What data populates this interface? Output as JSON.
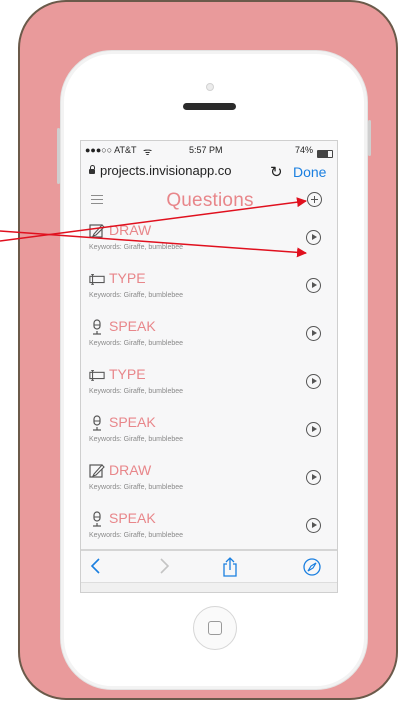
{
  "status_bar": {
    "carrier": "●●●○○ AT&T",
    "wifi": "wifi-icon",
    "time": "5:57 PM",
    "battery": "74%",
    "battery_level": 0.74
  },
  "browser": {
    "url": "projects.invisionapp.co",
    "done_label": "Done"
  },
  "app_bar": {
    "title": "Questions"
  },
  "rows": [
    {
      "title": "DRAW",
      "keywords": "Keywords: Giraffe, bumblebee",
      "icon": "draw-icon"
    },
    {
      "title": "TYPE",
      "keywords": "Keywords: Giraffe, bumblebee",
      "icon": "keyboard-icon"
    },
    {
      "title": "SPEAK",
      "keywords": "Keywords: Giraffe, bumblebee",
      "icon": "microphone-icon"
    },
    {
      "title": "TYPE",
      "keywords": "Keywords: Giraffe, bumblebee",
      "icon": "keyboard-icon"
    },
    {
      "title": "SPEAK",
      "keywords": "Keywords: Giraffe, bumblebee",
      "icon": "microphone-icon"
    },
    {
      "title": "DRAW",
      "keywords": "Keywords: Giraffe, bumblebee",
      "icon": "draw-icon"
    },
    {
      "title": "SPEAK",
      "keywords": "Keywords: Giraffe, bumblebee",
      "icon": "microphone-icon"
    }
  ],
  "colors": {
    "accent": "#e8868a",
    "frame": "#e99a9b",
    "link": "#1a7fe0",
    "annotation_arrow": "#e0101e"
  }
}
